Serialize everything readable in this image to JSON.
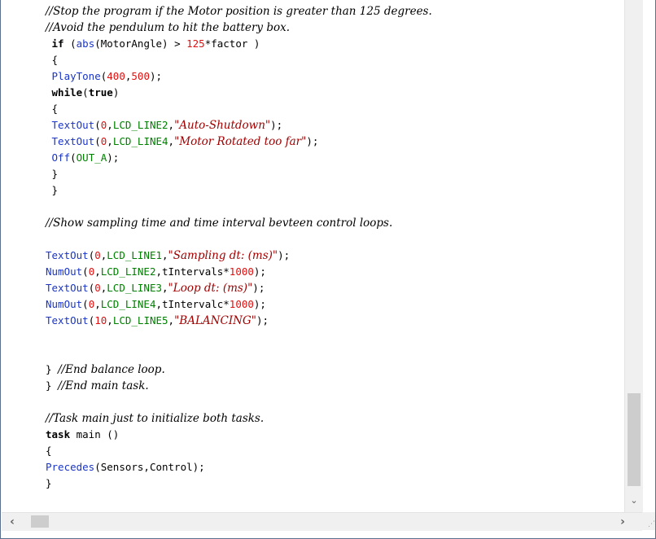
{
  "code_lines": [
    [
      {
        "c": "cm",
        "t": "//Stop the program if the Motor position is greater than 125 degrees."
      }
    ],
    [
      {
        "c": "cm",
        "t": "//Avoid the pendulum to hit the battery box."
      }
    ],
    [
      {
        "c": "pl",
        "t": " "
      },
      {
        "c": "kw",
        "t": "if"
      },
      {
        "c": "pl",
        "t": " ("
      },
      {
        "c": "fn",
        "t": "abs"
      },
      {
        "c": "pl",
        "t": "(MotorAngle) > "
      },
      {
        "c": "nm",
        "t": "125"
      },
      {
        "c": "pl",
        "t": "*factor )"
      }
    ],
    [
      {
        "c": "pl",
        "t": " {"
      }
    ],
    [
      {
        "c": "pl",
        "t": " "
      },
      {
        "c": "fn",
        "t": "PlayTone"
      },
      {
        "c": "pl",
        "t": "("
      },
      {
        "c": "nm",
        "t": "400"
      },
      {
        "c": "pl",
        "t": ","
      },
      {
        "c": "nm",
        "t": "500"
      },
      {
        "c": "pl",
        "t": ");"
      }
    ],
    [
      {
        "c": "pl",
        "t": " "
      },
      {
        "c": "kw",
        "t": "while"
      },
      {
        "c": "pl",
        "t": "("
      },
      {
        "c": "kw",
        "t": "true"
      },
      {
        "c": "pl",
        "t": ")"
      }
    ],
    [
      {
        "c": "pl",
        "t": " {"
      }
    ],
    [
      {
        "c": "pl",
        "t": " "
      },
      {
        "c": "fn",
        "t": "TextOut"
      },
      {
        "c": "pl",
        "t": "("
      },
      {
        "c": "nm",
        "t": "0"
      },
      {
        "c": "pl",
        "t": ","
      },
      {
        "c": "cn",
        "t": "LCD_LINE2"
      },
      {
        "c": "pl",
        "t": ","
      },
      {
        "c": "st",
        "t": "\"Auto-Shutdown\""
      },
      {
        "c": "pl",
        "t": ");"
      }
    ],
    [
      {
        "c": "pl",
        "t": " "
      },
      {
        "c": "fn",
        "t": "TextOut"
      },
      {
        "c": "pl",
        "t": "("
      },
      {
        "c": "nm",
        "t": "0"
      },
      {
        "c": "pl",
        "t": ","
      },
      {
        "c": "cn",
        "t": "LCD_LINE4"
      },
      {
        "c": "pl",
        "t": ","
      },
      {
        "c": "st",
        "t": "\"Motor Rotated too far\""
      },
      {
        "c": "pl",
        "t": ");"
      }
    ],
    [
      {
        "c": "pl",
        "t": " "
      },
      {
        "c": "fn",
        "t": "Off"
      },
      {
        "c": "pl",
        "t": "("
      },
      {
        "c": "cn",
        "t": "OUT_A"
      },
      {
        "c": "pl",
        "t": ");"
      }
    ],
    [
      {
        "c": "pl",
        "t": " }"
      }
    ],
    [
      {
        "c": "pl",
        "t": " }"
      }
    ],
    [],
    [
      {
        "c": "cm",
        "t": "//Show sampling time and time interval bevteen control loops."
      }
    ],
    [],
    [
      {
        "c": "fn",
        "t": "TextOut"
      },
      {
        "c": "pl",
        "t": "("
      },
      {
        "c": "nm",
        "t": "0"
      },
      {
        "c": "pl",
        "t": ","
      },
      {
        "c": "cn",
        "t": "LCD_LINE1"
      },
      {
        "c": "pl",
        "t": ","
      },
      {
        "c": "st",
        "t": "\"Sampling dt: (ms)\""
      },
      {
        "c": "pl",
        "t": ");"
      }
    ],
    [
      {
        "c": "fn",
        "t": "NumOut"
      },
      {
        "c": "pl",
        "t": "("
      },
      {
        "c": "nm",
        "t": "0"
      },
      {
        "c": "pl",
        "t": ","
      },
      {
        "c": "cn",
        "t": "LCD_LINE2"
      },
      {
        "c": "pl",
        "t": ",tIntervals*"
      },
      {
        "c": "nm",
        "t": "1000"
      },
      {
        "c": "pl",
        "t": ");"
      }
    ],
    [
      {
        "c": "fn",
        "t": "TextOut"
      },
      {
        "c": "pl",
        "t": "("
      },
      {
        "c": "nm",
        "t": "0"
      },
      {
        "c": "pl",
        "t": ","
      },
      {
        "c": "cn",
        "t": "LCD_LINE3"
      },
      {
        "c": "pl",
        "t": ","
      },
      {
        "c": "st",
        "t": "\"Loop dt: (ms)\""
      },
      {
        "c": "pl",
        "t": ");"
      }
    ],
    [
      {
        "c": "fn",
        "t": "NumOut"
      },
      {
        "c": "pl",
        "t": "("
      },
      {
        "c": "nm",
        "t": "0"
      },
      {
        "c": "pl",
        "t": ","
      },
      {
        "c": "cn",
        "t": "LCD_LINE4"
      },
      {
        "c": "pl",
        "t": ",tIntervalc*"
      },
      {
        "c": "nm",
        "t": "1000"
      },
      {
        "c": "pl",
        "t": ");"
      }
    ],
    [
      {
        "c": "fn",
        "t": "TextOut"
      },
      {
        "c": "pl",
        "t": "("
      },
      {
        "c": "nm",
        "t": "10"
      },
      {
        "c": "pl",
        "t": ","
      },
      {
        "c": "cn",
        "t": "LCD_LINE5"
      },
      {
        "c": "pl",
        "t": ","
      },
      {
        "c": "st",
        "t": "\"BALANCING\""
      },
      {
        "c": "pl",
        "t": ");"
      }
    ],
    [],
    [],
    [
      {
        "c": "pl",
        "t": "} "
      },
      {
        "c": "cm",
        "t": "//End balance loop."
      }
    ],
    [
      {
        "c": "pl",
        "t": "} "
      },
      {
        "c": "cm",
        "t": "//End main task."
      }
    ],
    [],
    [
      {
        "c": "cm",
        "t": "//Task main just to initialize both tasks."
      }
    ],
    [
      {
        "c": "kw",
        "t": "task"
      },
      {
        "c": "pl",
        "t": " main ()"
      }
    ],
    [
      {
        "c": "pl",
        "t": "{"
      }
    ],
    [
      {
        "c": "fn",
        "t": "Precedes"
      },
      {
        "c": "pl",
        "t": "(Sensors,Control);"
      }
    ],
    [
      {
        "c": "pl",
        "t": "}"
      }
    ]
  ],
  "icons": {
    "scroll_down": "chevron-down-icon",
    "scroll_left": "chevron-left-icon",
    "scroll_right": "chevron-right-icon",
    "resize_grip": "resize-grip-icon"
  },
  "colors": {
    "function": "#1a35c7",
    "constant": "#008000",
    "number": "#e01010",
    "string": "#a00000",
    "keyword": "#000000",
    "comment": "#000000"
  },
  "glyphs": {
    "down": "⌄",
    "left": "‹",
    "right": "›",
    "grip": "⋰"
  }
}
